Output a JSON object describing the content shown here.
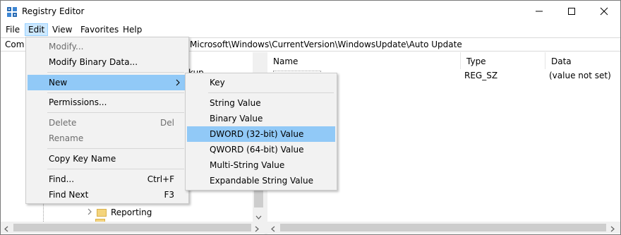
{
  "window": {
    "title": "Registry Editor",
    "icons": {
      "app": "registry-editor-icon",
      "minimize": "minimize-icon",
      "maximize": "maximize-icon",
      "close": "close-icon"
    }
  },
  "menubar": {
    "items": [
      {
        "label": "File"
      },
      {
        "label": "Edit"
      },
      {
        "label": "View"
      },
      {
        "label": "Favorites"
      },
      {
        "label": "Help"
      }
    ]
  },
  "address": {
    "left_text": "Com",
    "right_text": "Microsoft\\Windows\\CurrentVersion\\WindowsUpdate\\Auto Update"
  },
  "edit_menu": {
    "items": [
      {
        "label": "Modify...",
        "enabled": false
      },
      {
        "label": "Modify Binary Data...",
        "enabled": true
      },
      {
        "label": "New",
        "enabled": true,
        "submenu": true
      },
      {
        "label": "Permissions...",
        "enabled": true
      },
      {
        "label": "Delete",
        "shortcut": "Del",
        "enabled": false
      },
      {
        "label": "Rename",
        "enabled": false
      },
      {
        "label": "Copy Key Name",
        "enabled": true
      },
      {
        "label": "Find...",
        "shortcut": "Ctrl+F",
        "enabled": true
      },
      {
        "label": "Find Next",
        "shortcut": "F3",
        "enabled": true
      }
    ]
  },
  "new_submenu": {
    "items": [
      {
        "label": "Key"
      },
      {
        "label": "String Value"
      },
      {
        "label": "Binary Value"
      },
      {
        "label": "DWORD (32-bit) Value",
        "highlighted": true
      },
      {
        "label": "QWORD (64-bit) Value"
      },
      {
        "label": "Multi-String Value"
      },
      {
        "label": "Expandable String Value"
      }
    ]
  },
  "tree": {
    "visible_fragment": "kup",
    "nodes": [
      {
        "label": "Reporting"
      }
    ]
  },
  "values": {
    "columns": [
      "Name",
      "Type",
      "Data"
    ],
    "rows": [
      {
        "name": "",
        "type": "REG_SZ",
        "data": "(value not set)"
      }
    ]
  },
  "colors": {
    "highlight": "#91c9f7",
    "menu_active": "#cce8ff",
    "menu_bg": "#f2f2f2"
  }
}
